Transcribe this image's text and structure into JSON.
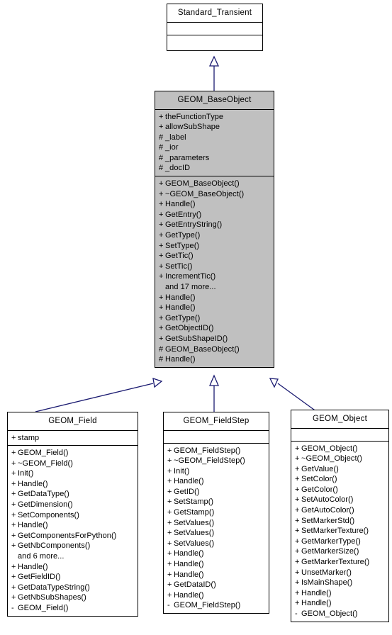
{
  "diagram": {
    "type": "uml-class-inheritance",
    "title_text": "GEOM class inheritance diagram",
    "edge_color": "#191970",
    "shaded_fill": "#c0c0c0",
    "plain_fill": "#ffffff",
    "border_color": "#000000"
  },
  "classes": {
    "standard_transient": {
      "name": "Standard_Transient",
      "shaded": false,
      "attributes": [],
      "operations": []
    },
    "geom_baseobject": {
      "name": "GEOM_BaseObject",
      "shaded": true,
      "attributes": [
        {
          "vis": "+",
          "label": "theFunctionType"
        },
        {
          "vis": "+",
          "label": "allowSubShape"
        },
        {
          "vis": "#",
          "label": "_label"
        },
        {
          "vis": "#",
          "label": "_ior"
        },
        {
          "vis": "#",
          "label": "_parameters"
        },
        {
          "vis": "#",
          "label": "_docID"
        }
      ],
      "operations": [
        {
          "vis": "+",
          "label": "GEOM_BaseObject()"
        },
        {
          "vis": "+",
          "label": "~GEOM_BaseObject()"
        },
        {
          "vis": "+",
          "label": "Handle()"
        },
        {
          "vis": "+",
          "label": "GetEntry()"
        },
        {
          "vis": "+",
          "label": "GetEntryString()"
        },
        {
          "vis": "+",
          "label": "GetType()"
        },
        {
          "vis": "+",
          "label": "SetType()"
        },
        {
          "vis": "+",
          "label": "GetTic()"
        },
        {
          "vis": "+",
          "label": "SetTic()"
        },
        {
          "vis": "+",
          "label": "IncrementTic()"
        },
        {
          "vis": "",
          "label": "and 17 more..."
        },
        {
          "vis": "+",
          "label": "Handle()"
        },
        {
          "vis": "+",
          "label": "Handle()"
        },
        {
          "vis": "+",
          "label": "GetType()"
        },
        {
          "vis": "+",
          "label": "GetObjectID()"
        },
        {
          "vis": "+",
          "label": "GetSubShapeID()"
        },
        {
          "vis": "#",
          "label": "GEOM_BaseObject()"
        },
        {
          "vis": "#",
          "label": "Handle()"
        }
      ]
    },
    "geom_field": {
      "name": "GEOM_Field",
      "shaded": false,
      "attributes": [
        {
          "vis": "+",
          "label": "stamp"
        }
      ],
      "operations": [
        {
          "vis": "+",
          "label": "GEOM_Field()"
        },
        {
          "vis": "+",
          "label": "~GEOM_Field()"
        },
        {
          "vis": "+",
          "label": "Init()"
        },
        {
          "vis": "+",
          "label": "Handle()"
        },
        {
          "vis": "+",
          "label": "GetDataType()"
        },
        {
          "vis": "+",
          "label": "GetDimension()"
        },
        {
          "vis": "+",
          "label": "SetComponents()"
        },
        {
          "vis": "+",
          "label": "Handle()"
        },
        {
          "vis": "+",
          "label": "GetComponentsForPython()"
        },
        {
          "vis": "+",
          "label": "GetNbComponents()"
        },
        {
          "vis": "",
          "label": "and 6 more..."
        },
        {
          "vis": "+",
          "label": "Handle()"
        },
        {
          "vis": "+",
          "label": "GetFieldID()"
        },
        {
          "vis": "+",
          "label": "GetDataTypeString()"
        },
        {
          "vis": "+",
          "label": "GetNbSubShapes()"
        },
        {
          "vis": "-",
          "label": "GEOM_Field()"
        }
      ]
    },
    "geom_fieldstep": {
      "name": "GEOM_FieldStep",
      "shaded": false,
      "attributes": [],
      "operations": [
        {
          "vis": "+",
          "label": "GEOM_FieldStep()"
        },
        {
          "vis": "+",
          "label": "~GEOM_FieldStep()"
        },
        {
          "vis": "+",
          "label": "Init()"
        },
        {
          "vis": "+",
          "label": "Handle()"
        },
        {
          "vis": "+",
          "label": "GetID()"
        },
        {
          "vis": "+",
          "label": "SetStamp()"
        },
        {
          "vis": "+",
          "label": "GetStamp()"
        },
        {
          "vis": "+",
          "label": "SetValues()"
        },
        {
          "vis": "+",
          "label": "SetValues()"
        },
        {
          "vis": "+",
          "label": "SetValues()"
        },
        {
          "vis": "+",
          "label": "Handle()"
        },
        {
          "vis": "+",
          "label": "Handle()"
        },
        {
          "vis": "+",
          "label": "Handle()"
        },
        {
          "vis": "+",
          "label": "GetDataID()"
        },
        {
          "vis": "+",
          "label": "Handle()"
        },
        {
          "vis": "-",
          "label": "GEOM_FieldStep()"
        }
      ]
    },
    "geom_object": {
      "name": "GEOM_Object",
      "shaded": false,
      "attributes": [],
      "operations": [
        {
          "vis": "+",
          "label": "GEOM_Object()"
        },
        {
          "vis": "+",
          "label": "~GEOM_Object()"
        },
        {
          "vis": "+",
          "label": "GetValue()"
        },
        {
          "vis": "+",
          "label": "SetColor()"
        },
        {
          "vis": "+",
          "label": "GetColor()"
        },
        {
          "vis": "+",
          "label": "SetAutoColor()"
        },
        {
          "vis": "+",
          "label": "GetAutoColor()"
        },
        {
          "vis": "+",
          "label": "SetMarkerStd()"
        },
        {
          "vis": "+",
          "label": "SetMarkerTexture()"
        },
        {
          "vis": "+",
          "label": "GetMarkerType()"
        },
        {
          "vis": "+",
          "label": "GetMarkerSize()"
        },
        {
          "vis": "+",
          "label": "GetMarkerTexture()"
        },
        {
          "vis": "+",
          "label": "UnsetMarker()"
        },
        {
          "vis": "+",
          "label": "IsMainShape()"
        },
        {
          "vis": "+",
          "label": "Handle()"
        },
        {
          "vis": "+",
          "label": "Handle()"
        },
        {
          "vis": "-",
          "label": "GEOM_Object()"
        }
      ]
    }
  },
  "edges": [
    {
      "from": "geom_baseobject",
      "to": "standard_transient",
      "kind": "inheritance"
    },
    {
      "from": "geom_field",
      "to": "geom_baseobject",
      "kind": "inheritance"
    },
    {
      "from": "geom_fieldstep",
      "to": "geom_baseobject",
      "kind": "inheritance"
    },
    {
      "from": "geom_object",
      "to": "geom_baseobject",
      "kind": "inheritance"
    }
  ]
}
